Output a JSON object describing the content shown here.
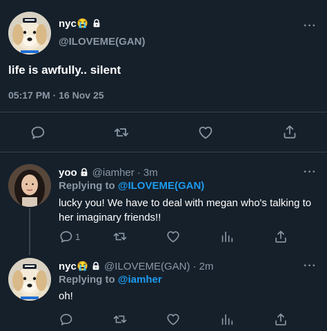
{
  "main_tweet": {
    "display_name": "nyc",
    "emoji": "😭",
    "handle": "@ILOVEME(GAN)",
    "text": "life is awfully.. silent",
    "timestamp": "05:17 PM · 16 Nov 25",
    "more_label": "···"
  },
  "reply1": {
    "display_name": "yoo",
    "handle": "@iamher",
    "time": "· 3m",
    "replying_prefix": "Replying to",
    "replying_handle": "@ILOVEME(GAN)",
    "text": "lucky you! We have to deal with megan who's talking to her imaginary friends!!",
    "reply_count": "1",
    "more_label": "···"
  },
  "reply2": {
    "display_name": "nyc",
    "emoji": "😭",
    "handle": "@ILOVEME(GAN)",
    "time": "· 2m",
    "replying_prefix": "Replying to",
    "replying_handle": "@iamher",
    "text": "oh!",
    "more_label": "···"
  },
  "icons": [
    "lock-icon",
    "reply-icon",
    "retweet-icon",
    "like-icon",
    "share-icon",
    "analytics-icon",
    "more-icon"
  ],
  "colors": {
    "background": "#15202b",
    "link": "#1d9bf0",
    "muted": "#8b98a5",
    "divider": "#38444d"
  }
}
